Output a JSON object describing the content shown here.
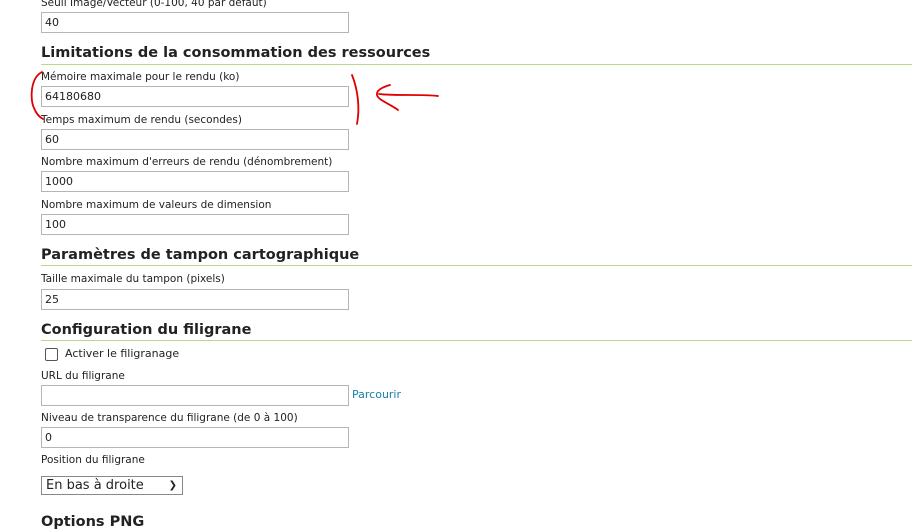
{
  "fields_top": {
    "label": "Seuil Image/Vecteur (0-100, 40 par défaut)",
    "value": "40"
  },
  "resources": {
    "heading": "Limitations de la consommation des ressources",
    "fields": [
      {
        "label": "Mémoire maximale pour le rendu (ko)",
        "value": "64180680"
      },
      {
        "label": "Temps maximum de rendu (secondes)",
        "value": "60"
      },
      {
        "label": "Nombre maximum d'erreurs de rendu (dénombrement)",
        "value": "1000"
      },
      {
        "label": "Nombre maximum de valeurs de dimension",
        "value": "100"
      }
    ]
  },
  "buffer": {
    "heading": "Paramètres de tampon cartographique",
    "field": {
      "label": "Taille maximale du tampon (pixels)",
      "value": "25"
    }
  },
  "watermark": {
    "heading": "Configuration du filigrane",
    "enable_label": "Activer le filigranage",
    "enabled": false,
    "url_label": "URL du filigrane",
    "url_value": "",
    "browse_label": "Parcourir",
    "transparency_label": "Niveau de transparence du filigrane (de 0 à 100)",
    "transparency_value": "0",
    "position_label": "Position du filigrane",
    "position_value": "En bas à droite"
  },
  "png": {
    "heading": "Options PNG"
  },
  "colors": {
    "accent_rule": "#b9d88a",
    "link": "#1a7fa8",
    "annotation": "#e00000"
  }
}
